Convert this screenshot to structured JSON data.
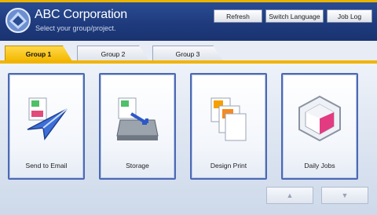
{
  "header": {
    "title": "ABC Corporation",
    "subtitle": "Select your group/project.",
    "buttons": [
      "Refresh",
      "Switch Language",
      "Job Log"
    ]
  },
  "tabs": [
    {
      "label": "Group 1",
      "active": true
    },
    {
      "label": "Group 2",
      "active": false
    },
    {
      "label": "Group 3",
      "active": false
    }
  ],
  "tiles": [
    {
      "label": "Send to Email",
      "icon": "send-email-icon"
    },
    {
      "label": "Storage",
      "icon": "storage-icon"
    },
    {
      "label": "Design Print",
      "icon": "design-print-icon"
    },
    {
      "label": "Daily Jobs",
      "icon": "daily-jobs-icon"
    }
  ],
  "pager": {
    "up": "▲",
    "down": "▼"
  },
  "colors": {
    "header": "#1f3b7d",
    "accent": "#f0b400",
    "tile_border": "#4c69b4"
  }
}
